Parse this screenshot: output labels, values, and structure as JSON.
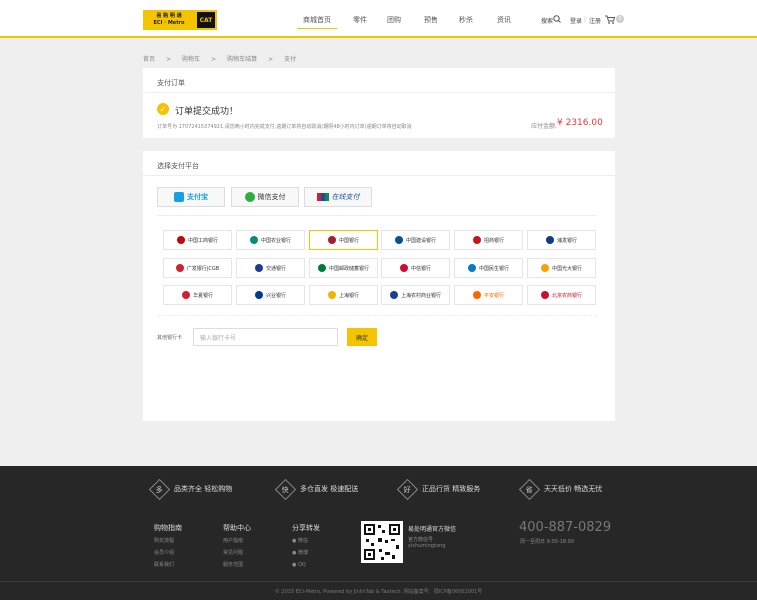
{
  "header": {
    "logo_line1": "易 购 明 通",
    "logo_line2": "ECI · Metro",
    "logo_cat": "CAT",
    "nav": [
      "商城首页",
      "零件",
      "团购",
      "预售",
      "秒杀",
      "资讯"
    ],
    "search_label": "搜索",
    "login": "登录",
    "separator": "|",
    "register": "注册",
    "cart_count": "0"
  },
  "breadcrumb": [
    "首页",
    ">",
    "购物车",
    ">",
    "购物车结算",
    ">",
    "支付"
  ],
  "order": {
    "title": "支付订单",
    "success": "订单提交成功！",
    "info": "订单号为 17072415374921,请您两小时内完成支付,逾期订单将自动取消(期限48小时内订单)逾期订单将自动取消",
    "amount_label": "应付金额:",
    "amount": "¥ 2316.00"
  },
  "payment": {
    "title": "选择支付平台",
    "platforms": [
      "支付宝",
      "微信支付",
      "在线支付"
    ],
    "banks": [
      [
        "中国工商银行",
        "中国农业银行",
        "中国银行",
        "中国建设银行",
        "招商银行",
        "浦发银行"
      ],
      [
        "广发银行|CGB",
        "交通银行",
        "中国邮政储蓄银行",
        "中信银行",
        "中国民生银行",
        "中国光大银行"
      ],
      [
        "华夏银行",
        "兴业银行",
        "上海银行",
        "上海农村商业银行",
        "平安银行",
        "北京农商银行"
      ]
    ],
    "other_label": "其他银行卡",
    "card_placeholder": "输入银行卡号",
    "confirm": "确定"
  },
  "footer": {
    "features": [
      {
        "icon": "多",
        "text": "品类齐全 轻松购物"
      },
      {
        "icon": "快",
        "text": "多仓直发 极速配送"
      },
      {
        "icon": "好",
        "text": "正品行货 精致服务"
      },
      {
        "icon": "省",
        "text": "天天低价 畅选无忧"
      }
    ],
    "col1": {
      "h": "购物指南",
      "items": [
        "购买流程",
        "会员介绍",
        "联系我们"
      ]
    },
    "col2": {
      "h": "帮助中心",
      "items": [
        "用户指南",
        "常见问题",
        "服务范围"
      ]
    },
    "col3": {
      "h": "分享转发",
      "items": [
        "微信",
        "微博",
        "QQ"
      ]
    },
    "wechat_title": "易处明通官方微信",
    "wechat_sub": "官方微信号",
    "wechat_id": "yichumingtong",
    "phone": "400-887-0829",
    "hours": "周一至周日 9:00-18:00",
    "copyright": "© 2015 ECI-Metro, Powered by JinlinTab & Taotech.  网站备案号：鄂ICP备06002001号"
  }
}
